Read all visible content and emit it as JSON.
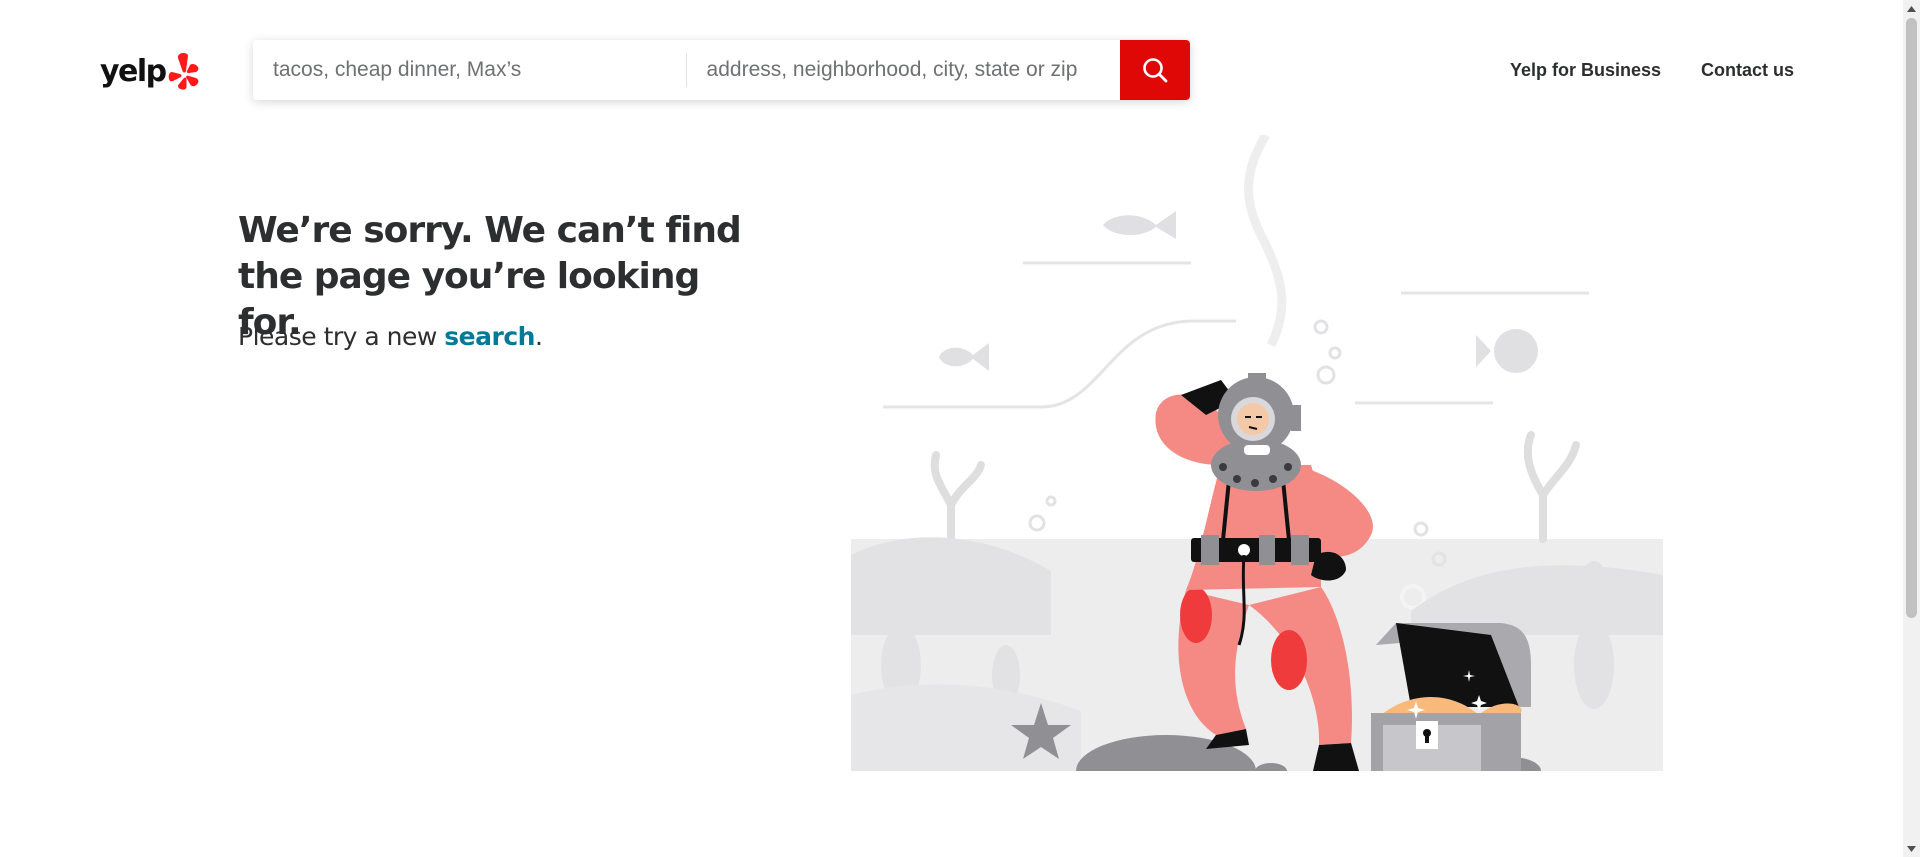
{
  "header": {
    "logo_text": "yelp",
    "search": {
      "find_placeholder": "tacos, cheap dinner, Max’s",
      "near_placeholder": "address, neighborhood, city, state or zip"
    },
    "nav": {
      "business_label": "Yelp for Business",
      "contact_label": "Contact us"
    }
  },
  "main": {
    "headline": "We’re sorry. We can’t find the page you’re looking for.",
    "subtext_prefix": "Please try a new ",
    "subtext_link": "search",
    "subtext_suffix": "."
  },
  "colors": {
    "brand_red": "#e00707",
    "link_teal": "#027a97",
    "text_dark": "#2d2e2f"
  },
  "icons": {
    "logo_burst": "yelp-burst-icon",
    "search": "search-icon",
    "scroll_up": "triangle-up-icon",
    "scroll_down": "triangle-down-icon"
  }
}
